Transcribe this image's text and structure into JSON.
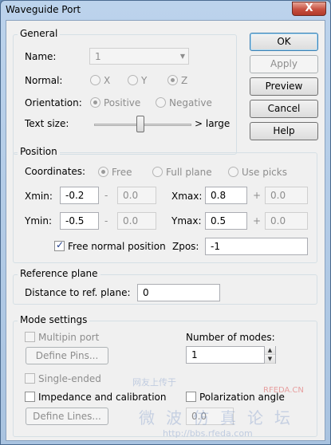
{
  "window": {
    "title": "Waveguide Port",
    "close_glyph": "X"
  },
  "buttons": {
    "ok": "OK",
    "apply": "Apply",
    "preview": "Preview",
    "cancel": "Cancel",
    "help": "Help"
  },
  "general": {
    "title": "General",
    "name_label": "Name:",
    "name_value": "1",
    "normal_label": "Normal:",
    "normal_options": [
      "X",
      "Y",
      "Z"
    ],
    "normal_selected": "Z",
    "orientation_label": "Orientation:",
    "orientation_options": [
      "Positive",
      "Negative"
    ],
    "orientation_selected": "Positive",
    "text_size_label": "Text size:",
    "text_size_max_label": "> large",
    "text_size_level": 0.5
  },
  "position": {
    "title": "Position",
    "coordinates_label": "Coordinates:",
    "coordinates_options": [
      "Free",
      "Full plane",
      "Use picks"
    ],
    "coordinates_selected": "Free",
    "xmin_label": "Xmin:",
    "xmin_value": "-0.2",
    "xmin_offset_sign": "-",
    "xmin_offset": "0.0",
    "xmax_label": "Xmax:",
    "xmax_value": "0.8",
    "xmax_offset_sign": "+",
    "xmax_offset": "0.0",
    "ymin_label": "Ymin:",
    "ymin_value": "-0.5",
    "ymin_offset_sign": "-",
    "ymin_offset": "0.0",
    "ymax_label": "Ymax:",
    "ymax_value": "0.5",
    "ymax_offset_sign": "+",
    "ymax_offset": "0.0",
    "free_normal_label": "Free normal position",
    "free_normal_checked": true,
    "zpos_label": "Zpos:",
    "zpos_value": "-1"
  },
  "reference": {
    "title": "Reference plane",
    "distance_label": "Distance to ref. plane:",
    "distance_value": "0"
  },
  "mode": {
    "title": "Mode settings",
    "multipin_label": "Multipin port",
    "define_pins_label": "Define Pins...",
    "num_modes_label": "Number of modes:",
    "num_modes_value": "1",
    "single_ended_label": "Single-ended",
    "impedance_label": "Impedance and calibration",
    "polarization_label": "Polarization angle",
    "polarization_value": "0.0",
    "define_lines_label": "Define Lines..."
  },
  "watermark": {
    "site": "RFEDA.CN",
    "forum": "微波仿真论坛",
    "url": "http://bbs.rfeda.com",
    "slogan": "网友上传于"
  },
  "colors": {
    "frame": "#a9c3e0",
    "client_bg": "#f0f0f0",
    "close_button": "#c75040",
    "disabled_text": "#8d8d8d"
  },
  "icons": {
    "close": "close-icon",
    "dropdown": "chevron-down-icon",
    "spin_up": "spin-up-icon",
    "spin_down": "spin-down-icon"
  }
}
